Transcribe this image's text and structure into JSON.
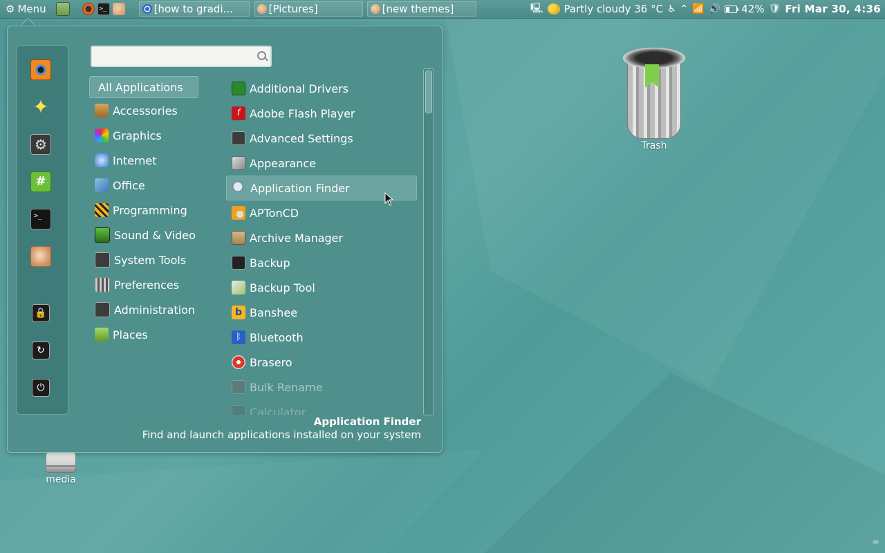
{
  "panel": {
    "menu_label": "Menu",
    "tasks": [
      {
        "label": "[how to gradi...",
        "icon": "chrome-icon"
      },
      {
        "label": "[Pictures]",
        "icon": "file-manager-icon"
      },
      {
        "label": "[new themes]",
        "icon": "shell-icon"
      }
    ],
    "weather": "Partly cloudy 36 °C",
    "battery": "42%",
    "battery_level": 0.42,
    "clock": "Fri Mar 30,  4:36"
  },
  "menu": {
    "search": {
      "value": "",
      "placeholder": ""
    },
    "categories": [
      {
        "label": "All Applications",
        "icon": "all-apps",
        "selected": true
      },
      {
        "label": "Accessories",
        "icon": "accessories-icon"
      },
      {
        "label": "Graphics",
        "icon": "graphics-icon"
      },
      {
        "label": "Internet",
        "icon": "internet-icon"
      },
      {
        "label": "Office",
        "icon": "office-icon"
      },
      {
        "label": "Programming",
        "icon": "programming-icon"
      },
      {
        "label": "Sound & Video",
        "icon": "sound-video-icon"
      },
      {
        "label": "System Tools",
        "icon": "system-tools-icon"
      },
      {
        "label": "Preferences",
        "icon": "preferences-icon"
      },
      {
        "label": "Administration",
        "icon": "administration-icon"
      },
      {
        "label": "Places",
        "icon": "folder-icon"
      }
    ],
    "apps": [
      {
        "label": "Additional Drivers",
        "icon": "chip-icon"
      },
      {
        "label": "Adobe Flash Player",
        "icon": "flash-icon"
      },
      {
        "label": "Advanced Settings",
        "icon": "settings-icon"
      },
      {
        "label": "Appearance",
        "icon": "appearance-icon"
      },
      {
        "label": "Application Finder",
        "icon": "magnifier-icon",
        "highlighted": true
      },
      {
        "label": "APTonCD",
        "icon": "aptoncd-icon"
      },
      {
        "label": "Archive Manager",
        "icon": "archive-icon"
      },
      {
        "label": "Backup",
        "icon": "backup-icon"
      },
      {
        "label": "Backup Tool",
        "icon": "backup-tool-icon"
      },
      {
        "label": "Banshee",
        "icon": "banshee-icon"
      },
      {
        "label": "Bluetooth",
        "icon": "bluetooth-icon"
      },
      {
        "label": "Brasero",
        "icon": "brasero-icon"
      },
      {
        "label": "Bulk Rename",
        "icon": "bulk-rename-icon"
      },
      {
        "label": "Calculator",
        "icon": "calculator-icon"
      }
    ],
    "description": {
      "title": "Application Finder",
      "text": "Find and launch applications installed on your system"
    }
  },
  "desktop": {
    "trash_label": "Trash",
    "media_label": "media"
  }
}
